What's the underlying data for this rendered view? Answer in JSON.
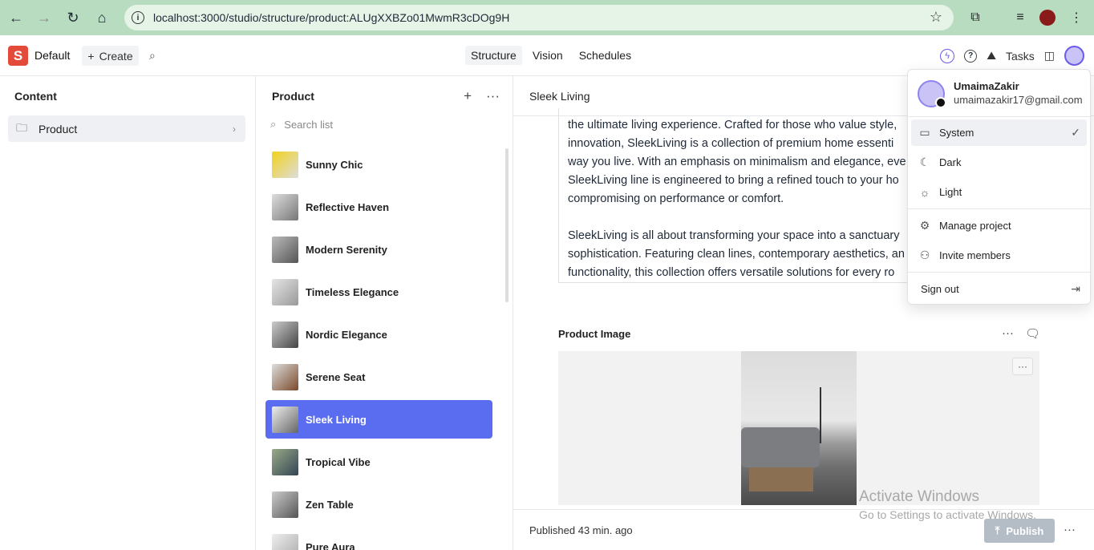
{
  "browser": {
    "url": "localhost:3000/studio/structure/product:ALUgXXBZo01MwmR3cDOg9H"
  },
  "studio": {
    "workspace": "Default",
    "create_label": "Create",
    "tabs": [
      "Structure",
      "Vision",
      "Schedules"
    ],
    "active_tab": "Structure",
    "tasks_label": "Tasks"
  },
  "content_pane": {
    "title": "Content",
    "item": "Product"
  },
  "list_pane": {
    "title": "Product",
    "search_placeholder": "Search list",
    "items": [
      "Sunny Chic",
      "Reflective Haven",
      "Modern Serenity",
      "Timeless Elegance",
      "Nordic Elegance",
      "Serene Seat",
      "Sleek Living",
      "Tropical Vibe",
      "Zen Table",
      "Pure Aura"
    ],
    "selected": "Sleek Living"
  },
  "document": {
    "title": "Sleek Living",
    "description_lines": [
      "the ultimate living experience. Crafted for those who value style,",
      "innovation, SleekLiving is a collection of premium home essenti",
      "way you live. With an emphasis on minimalism and elegance, eve",
      "SleekLiving line is engineered to bring a refined touch to your ho",
      "compromising on performance or comfort."
    ],
    "description_lines_2": [
      "SleekLiving is all about transforming your space into a sanctuary",
      "sophistication. Featuring clean lines, contemporary aesthetics, an",
      "functionality, this collection offers versatile solutions for every ro"
    ],
    "image_field_label": "Product Image",
    "published_status": "Published 43 min. ago",
    "publish_label": "Publish"
  },
  "user_menu": {
    "name": "UmaimaZakir",
    "email": "umaimazakir17@gmail.com",
    "items": {
      "system": "System",
      "dark": "Dark",
      "light": "Light",
      "manage": "Manage project",
      "invite": "Invite members",
      "signout": "Sign out"
    }
  },
  "watermark": {
    "line1": "Activate Windows",
    "line2": "Go to Settings to activate Windows."
  },
  "colors": {
    "accent": "#5a6cf0",
    "brand": "#e44a3a",
    "browser_frame": "#b8dcc0"
  }
}
